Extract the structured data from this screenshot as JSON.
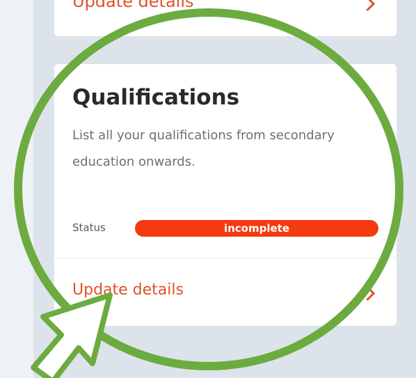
{
  "previous_card": {
    "link_label": "Update details",
    "link_icon": "chevron-right-icon"
  },
  "qualifications_card": {
    "title": "Qualifications",
    "description": "List all your qualifications from secondary education onwards.",
    "status_label": "Status",
    "status_value": "incomplete",
    "update_label": "Update details",
    "update_icon": "chevron-right-icon"
  },
  "annotation": {
    "ring_icon": "highlight-circle",
    "pointer_icon": "arrow-pointer-icon"
  },
  "colors": {
    "accent": "#e0512a",
    "status_incomplete": "#f43a0f",
    "highlight": "#6cab40",
    "background": "#dde3ea",
    "card": "#ffffff"
  }
}
